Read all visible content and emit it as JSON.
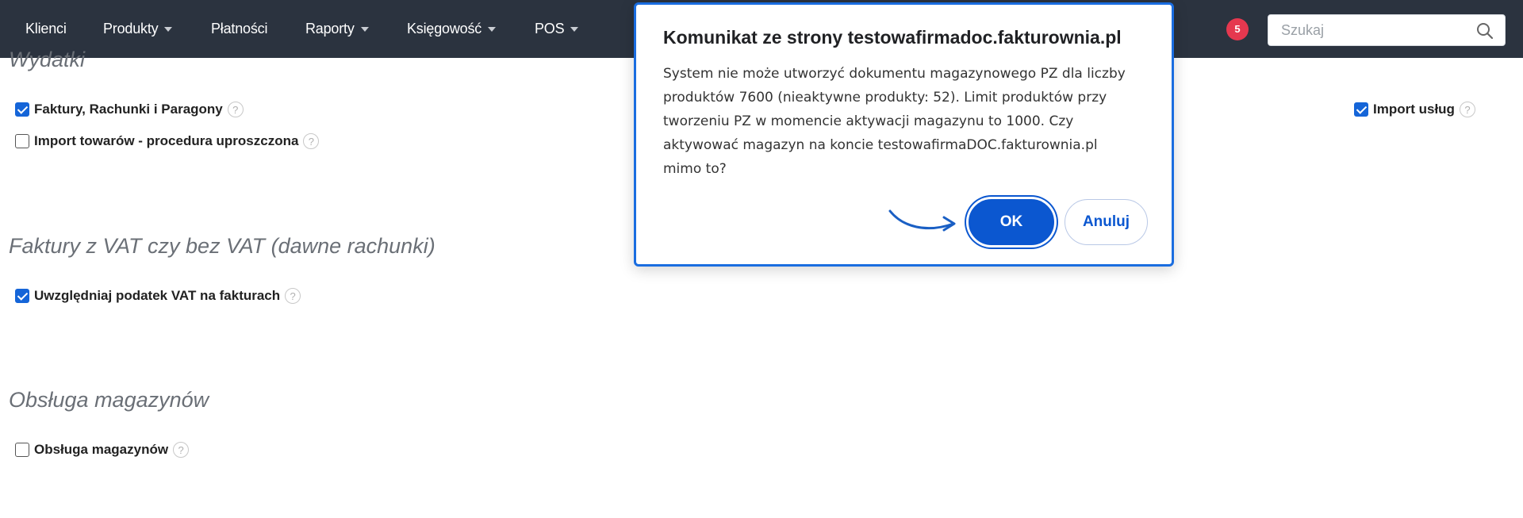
{
  "nav": {
    "items": [
      {
        "label": "Klienci",
        "dropdown": false
      },
      {
        "label": "Produkty",
        "dropdown": true
      },
      {
        "label": "Płatności",
        "dropdown": false
      },
      {
        "label": "Raporty",
        "dropdown": true
      },
      {
        "label": "Księgowość",
        "dropdown": true
      },
      {
        "label": "POS",
        "dropdown": true
      }
    ],
    "notification_count": "5",
    "search": {
      "placeholder": "Szukaj",
      "value": ""
    }
  },
  "sections": {
    "wydatki": {
      "title": "Wydatki",
      "checks": [
        {
          "label": "Faktury, Rachunki i Paragony",
          "checked": true
        },
        {
          "label": "Import towarów - procedura uproszczona",
          "checked": false
        },
        {
          "label": "Import usług",
          "checked": true
        }
      ]
    },
    "vat": {
      "title": "Faktury z VAT czy bez VAT (dawne rachunki)",
      "checks": [
        {
          "label": "Uwzględniaj podatek VAT na fakturach",
          "checked": true
        }
      ]
    },
    "magazyny": {
      "title": "Obsługa magazynów",
      "checks": [
        {
          "label": "Obsługa magazynów",
          "checked": false
        }
      ]
    }
  },
  "help_glyph": "?",
  "dialog": {
    "title": "Komunikat ze strony testowafirmadoc.fakturownia.pl",
    "message": "System nie może utworzyć dokumentu magazynowego PZ dla liczby produktów 7600 (nieaktywne produkty: 52). Limit produktów przy tworzeniu PZ w momencie aktywacji magazynu to 1000. Czy aktywować magazyn na koncie testowafirmaDOC.fakturownia.pl mimo to?",
    "ok_label": "OK",
    "cancel_label": "Anuluj"
  },
  "colors": {
    "navbar_bg": "#2b333f",
    "accent_blue": "#0b57d0",
    "badge_red": "#e5384f"
  },
  "icons": {
    "search": "search-icon",
    "annotation_arrow": "arrow-pointer-icon"
  }
}
